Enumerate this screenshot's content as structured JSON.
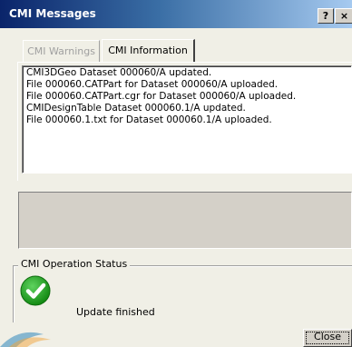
{
  "window": {
    "title": "CMI Messages",
    "help_button": "?",
    "close_button": "×"
  },
  "tabs": [
    {
      "label": "CMI Warnings",
      "active": false
    },
    {
      "label": "CMI Information",
      "active": true
    }
  ],
  "log_lines": [
    "CMI3DGeo Dataset 000060/A updated.",
    "File 000060.CATPart for Dataset 000060/A uploaded.",
    "File 000060.CATPart.cgr for Dataset 000060/A uploaded.",
    "CMIDesignTable Dataset 000060.1/A updated.",
    "File 000060.1.txt for Dataset 000060.1/A uploaded."
  ],
  "status_group": {
    "label": "CMI Operation Status",
    "icon": "check-circle-icon",
    "status_text": "Update finished",
    "status_color": "#1a8f1a"
  },
  "buttons": {
    "close_label": "Close"
  },
  "colors": {
    "titlebar_start": "#0a246a",
    "titlebar_end": "#a6caf0",
    "window_bg": "#f0efe6"
  }
}
